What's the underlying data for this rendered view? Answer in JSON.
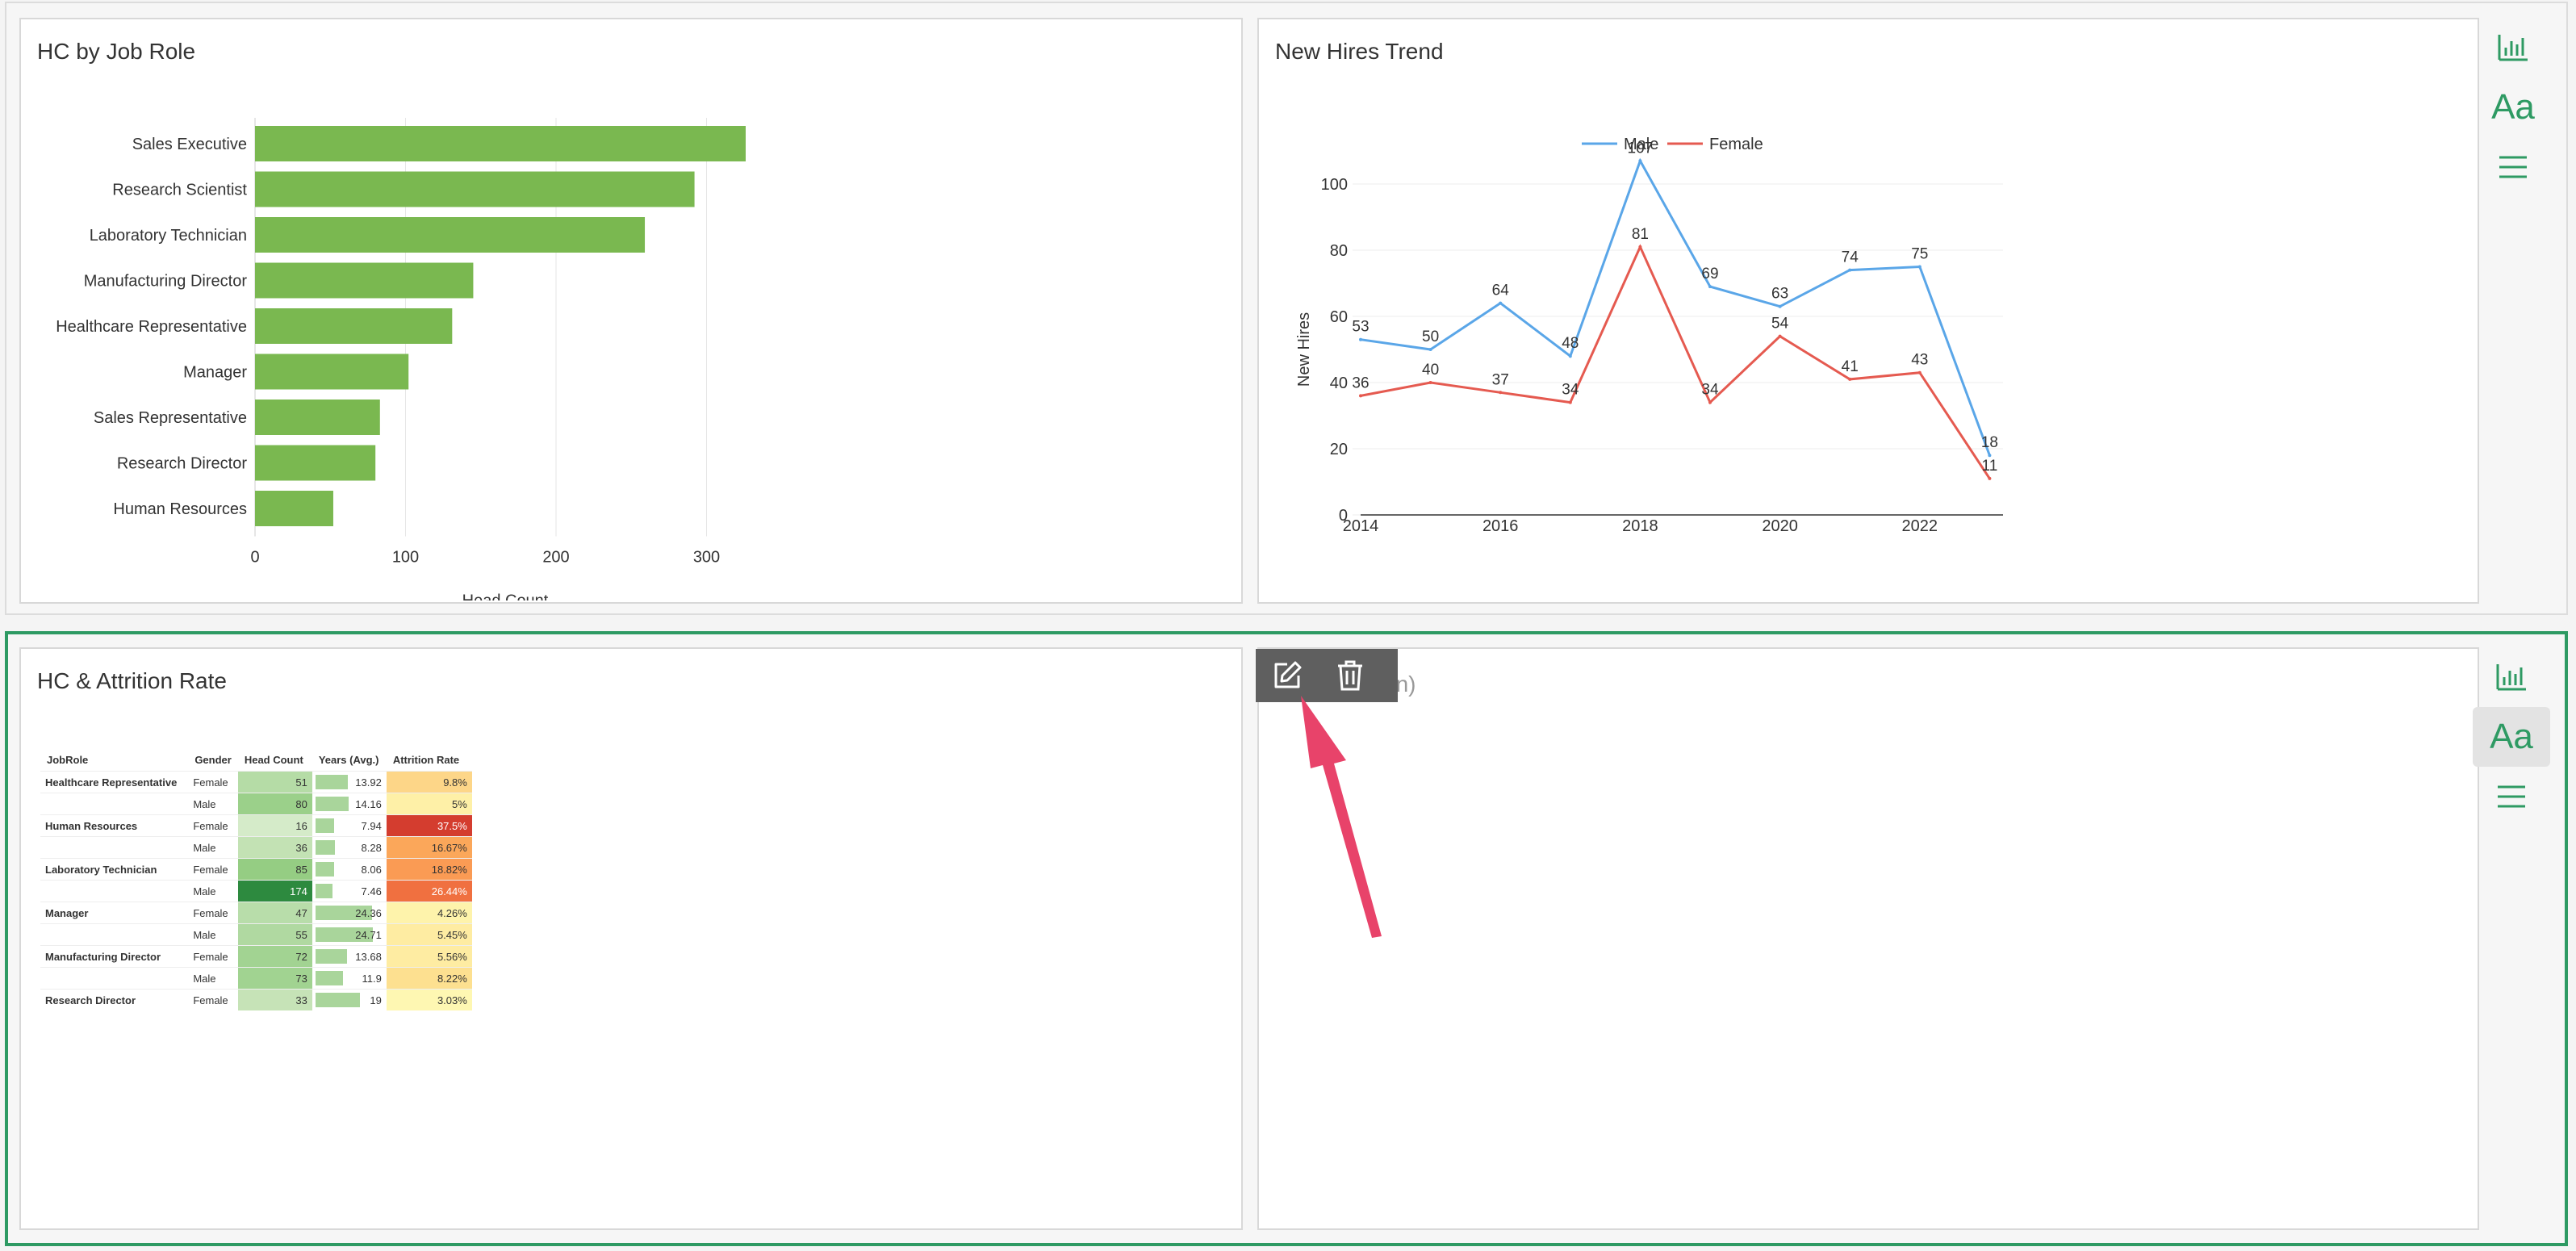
{
  "top_left": {
    "title": "HC by Job Role",
    "chart_data": {
      "type": "bar",
      "orientation": "horizontal",
      "categories": [
        "Sales Executive",
        "Research Scientist",
        "Laboratory Technician",
        "Manufacturing Director",
        "Healthcare Representative",
        "Manager",
        "Sales Representative",
        "Research Director",
        "Human Resources"
      ],
      "values": [
        326,
        292,
        259,
        145,
        131,
        102,
        83,
        80,
        52
      ],
      "xlabel": "Head Count",
      "xlim": [
        0,
        300
      ],
      "xticks": [
        "0",
        "100",
        "200",
        "300"
      ],
      "color": "#7ab850"
    }
  },
  "top_right": {
    "title": "New Hires Trend",
    "chart_data": {
      "type": "line",
      "x": [
        2014,
        2015,
        2016,
        2017,
        2018,
        2019,
        2020,
        2021,
        2022,
        2023
      ],
      "xticks": [
        "2014",
        "2016",
        "2018",
        "2020",
        "2022"
      ],
      "ylabel": "New Hires",
      "yticks": [
        "0",
        "20",
        "40",
        "60",
        "80",
        "100"
      ],
      "ylim": [
        0,
        100
      ],
      "legend": "top-center",
      "series": [
        {
          "name": "Male",
          "color": "#5aa6e8",
          "values": [
            53,
            50,
            64,
            48,
            107,
            69,
            63,
            74,
            75,
            18
          ]
        },
        {
          "name": "Female",
          "color": "#e55a50",
          "values": [
            36,
            40,
            37,
            34,
            81,
            34,
            54,
            41,
            43,
            11
          ]
        }
      ]
    }
  },
  "bottom_left": {
    "title": "HC & Attrition Rate",
    "table": {
      "headers": [
        "JobRole",
        "Gender",
        "Head Count",
        "Years (Avg.)",
        "Attrition Rate"
      ],
      "rows": [
        {
          "role": "Healthcare Representative",
          "gender": "Female",
          "hc": "51",
          "years": "13.92",
          "years_value": 13.92,
          "attr": "9.8%",
          "hc_color": "#b5dca6",
          "attr_color": "#fdd688",
          "attr_text": "#333"
        },
        {
          "role": "",
          "gender": "Male",
          "hc": "80",
          "years": "14.16",
          "years_value": 14.16,
          "attr": "5%",
          "hc_color": "#9bd08a",
          "attr_color": "#fef0a7",
          "attr_text": "#333"
        },
        {
          "role": "Human Resources",
          "gender": "Female",
          "hc": "16",
          "years": "7.94",
          "years_value": 7.94,
          "attr": "37.5%",
          "hc_color": "#d5ebc9",
          "attr_color": "#d43d2f",
          "attr_text": "#ffffff"
        },
        {
          "role": "",
          "gender": "Male",
          "hc": "36",
          "years": "8.28",
          "years_value": 8.28,
          "attr": "16.67%",
          "hc_color": "#c3e2b4",
          "attr_color": "#fba75a",
          "attr_text": "#333"
        },
        {
          "role": "Laboratory Technician",
          "gender": "Female",
          "hc": "85",
          "years": "8.06",
          "years_value": 8.06,
          "attr": "18.82%",
          "hc_color": "#95cd83",
          "attr_color": "#fa9b54",
          "attr_text": "#333"
        },
        {
          "role": "",
          "gender": "Male",
          "hc": "174",
          "years": "7.46",
          "years_value": 7.46,
          "attr": "26.44%",
          "hc_color": "#2d8a3f",
          "attr_color": "#f07040",
          "attr_text": "#ffffff"
        },
        {
          "role": "Manager",
          "gender": "Female",
          "hc": "47",
          "years": "24.36",
          "years_value": 24.36,
          "attr": "4.26%",
          "hc_color": "#b8ddaa",
          "attr_color": "#fef3ab",
          "attr_text": "#333"
        },
        {
          "role": "",
          "gender": "Male",
          "hc": "55",
          "years": "24.71",
          "years_value": 24.71,
          "attr": "5.45%",
          "hc_color": "#b0d9a1",
          "attr_color": "#feeca2",
          "attr_text": "#333"
        },
        {
          "role": "Manufacturing Director",
          "gender": "Female",
          "hc": "72",
          "years": "13.68",
          "years_value": 13.68,
          "attr": "5.56%",
          "hc_color": "#a2d392",
          "attr_color": "#feeca2",
          "attr_text": "#333"
        },
        {
          "role": "",
          "gender": "Male",
          "hc": "73",
          "years": "11.9",
          "years_value": 11.9,
          "attr": "8.22%",
          "hc_color": "#a1d391",
          "attr_color": "#fde090",
          "attr_text": "#333"
        },
        {
          "role": "Research Director",
          "gender": "Female",
          "hc": "33",
          "years": "19",
          "years_value": 19,
          "attr": "3.03%",
          "hc_color": "#c6e3b7",
          "attr_color": "#fef7b2",
          "attr_text": "#333"
        }
      ]
    }
  },
  "bottom_right": {
    "placeholder": "tion)"
  },
  "tools": {
    "chart_icon": "bar-chart-icon",
    "text_label": "Aa",
    "menu_icon": "menu-icon"
  },
  "edit_toolbar": {
    "edit_icon": "edit-icon",
    "delete_icon": "trash-icon"
  },
  "colors": {
    "accent": "#2e9a63",
    "arrow": "#e8436a"
  }
}
